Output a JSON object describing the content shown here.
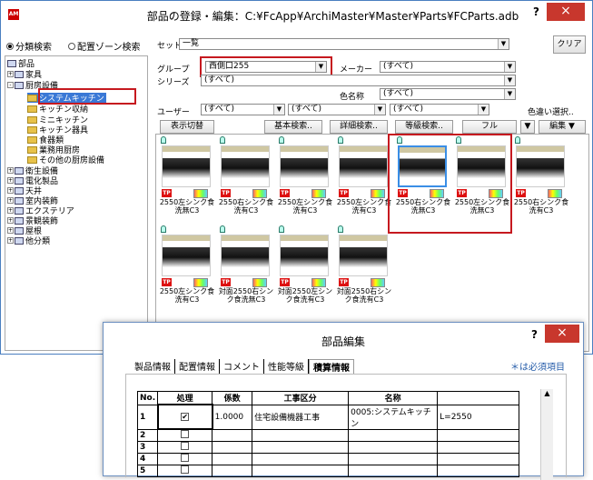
{
  "window": {
    "icon": "AM",
    "title": "部品の登録・編集：C:¥FcApp¥ArchiMaster¥Master¥Parts¥FCParts.adb",
    "help": "?",
    "close": "×"
  },
  "search": {
    "radio1": "分類検索",
    "radio2": "配置ゾーン検索",
    "set_label": "セット",
    "set_value": "一覧",
    "clear": "クリア"
  },
  "filters": {
    "group_label": "グループ",
    "group_value": "西側口255",
    "maker_label": "メーカー",
    "maker_value": "(すべて)",
    "series_label": "シリーズ",
    "series_value": "(すべて)",
    "color_label": "色名称",
    "color_value": "(すべて)",
    "user_label": "ユーザー",
    "user_value": "(すべて)",
    "user2": "(すべて)",
    "user3": "(すべて)",
    "color_select": "色違い選択.."
  },
  "toolbar": {
    "display_switch": "表示切替",
    "basic_search": "基本検索..",
    "detail_search": "詳細検索..",
    "grade_search": "等級検索..",
    "full": "フル",
    "edit": "編集"
  },
  "tree": {
    "root": "部品",
    "items": [
      "家具",
      "厨房設備",
      "システムキッチン",
      "キッチン収納",
      "ミニキッチン",
      "キッチン器具",
      "食器類",
      "業務用厨房",
      "その他の厨房設備",
      "衛生設備",
      "電化製品",
      "天井",
      "室内装飾",
      "エクステリア",
      "景観装飾",
      "屋根",
      "他分類"
    ]
  },
  "parts": [
    "2550左シンク食洗無C3",
    "2550右シンク食洗有C3",
    "2550左シンク食洗有C3",
    "2550左シンク食洗有C3",
    "2550右シンク食洗無C3",
    "2550左シンク食洗無C3",
    "2550右シンク食洗有C3",
    "2550左シンク食洗有C3",
    "対面2550右シンク食洗無C3",
    "対面2550左シンク食洗有C3",
    "対面2550右シンク食洗有C3"
  ],
  "tp_label": "TP",
  "dialog": {
    "title": "部品編集",
    "help": "?",
    "close": "×",
    "tabs": [
      "製品情報",
      "配置情報",
      "コメント",
      "性能等級",
      "積算情報"
    ],
    "required": "＊は必須項目",
    "columns": [
      "No.",
      "処理",
      "係数",
      "工事区分",
      "名称",
      ""
    ],
    "rows": [
      {
        "no": "1",
        "check": "✔",
        "coef": "1.0000",
        "kubun": "住宅設備機器工事",
        "name": "0005:システムキッチン",
        "spec": "L=2550"
      },
      {
        "no": "2"
      },
      {
        "no": "3"
      },
      {
        "no": "4"
      },
      {
        "no": "5"
      }
    ]
  }
}
